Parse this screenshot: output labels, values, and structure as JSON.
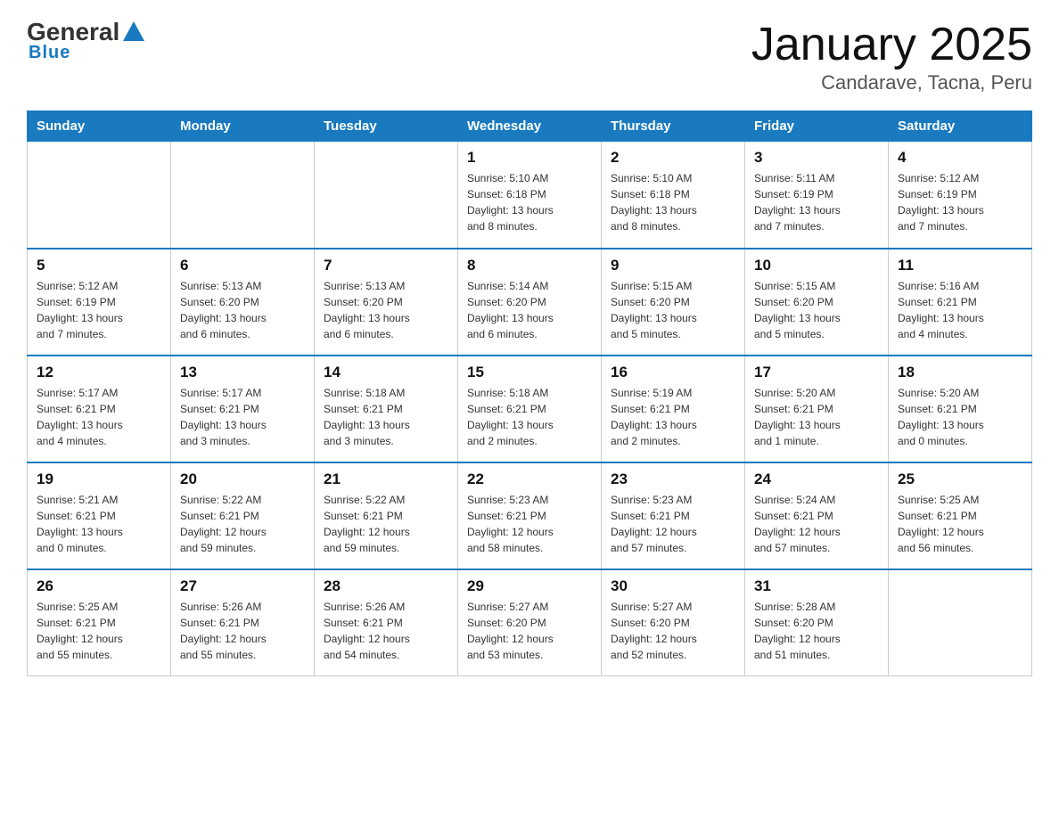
{
  "header": {
    "logo_general": "General",
    "logo_blue": "Blue",
    "title": "January 2025",
    "location": "Candarave, Tacna, Peru"
  },
  "days_of_week": [
    "Sunday",
    "Monday",
    "Tuesday",
    "Wednesday",
    "Thursday",
    "Friday",
    "Saturday"
  ],
  "weeks": [
    [
      {
        "day": "",
        "info": ""
      },
      {
        "day": "",
        "info": ""
      },
      {
        "day": "",
        "info": ""
      },
      {
        "day": "1",
        "info": "Sunrise: 5:10 AM\nSunset: 6:18 PM\nDaylight: 13 hours\nand 8 minutes."
      },
      {
        "day": "2",
        "info": "Sunrise: 5:10 AM\nSunset: 6:18 PM\nDaylight: 13 hours\nand 8 minutes."
      },
      {
        "day": "3",
        "info": "Sunrise: 5:11 AM\nSunset: 6:19 PM\nDaylight: 13 hours\nand 7 minutes."
      },
      {
        "day": "4",
        "info": "Sunrise: 5:12 AM\nSunset: 6:19 PM\nDaylight: 13 hours\nand 7 minutes."
      }
    ],
    [
      {
        "day": "5",
        "info": "Sunrise: 5:12 AM\nSunset: 6:19 PM\nDaylight: 13 hours\nand 7 minutes."
      },
      {
        "day": "6",
        "info": "Sunrise: 5:13 AM\nSunset: 6:20 PM\nDaylight: 13 hours\nand 6 minutes."
      },
      {
        "day": "7",
        "info": "Sunrise: 5:13 AM\nSunset: 6:20 PM\nDaylight: 13 hours\nand 6 minutes."
      },
      {
        "day": "8",
        "info": "Sunrise: 5:14 AM\nSunset: 6:20 PM\nDaylight: 13 hours\nand 6 minutes."
      },
      {
        "day": "9",
        "info": "Sunrise: 5:15 AM\nSunset: 6:20 PM\nDaylight: 13 hours\nand 5 minutes."
      },
      {
        "day": "10",
        "info": "Sunrise: 5:15 AM\nSunset: 6:20 PM\nDaylight: 13 hours\nand 5 minutes."
      },
      {
        "day": "11",
        "info": "Sunrise: 5:16 AM\nSunset: 6:21 PM\nDaylight: 13 hours\nand 4 minutes."
      }
    ],
    [
      {
        "day": "12",
        "info": "Sunrise: 5:17 AM\nSunset: 6:21 PM\nDaylight: 13 hours\nand 4 minutes."
      },
      {
        "day": "13",
        "info": "Sunrise: 5:17 AM\nSunset: 6:21 PM\nDaylight: 13 hours\nand 3 minutes."
      },
      {
        "day": "14",
        "info": "Sunrise: 5:18 AM\nSunset: 6:21 PM\nDaylight: 13 hours\nand 3 minutes."
      },
      {
        "day": "15",
        "info": "Sunrise: 5:18 AM\nSunset: 6:21 PM\nDaylight: 13 hours\nand 2 minutes."
      },
      {
        "day": "16",
        "info": "Sunrise: 5:19 AM\nSunset: 6:21 PM\nDaylight: 13 hours\nand 2 minutes."
      },
      {
        "day": "17",
        "info": "Sunrise: 5:20 AM\nSunset: 6:21 PM\nDaylight: 13 hours\nand 1 minute."
      },
      {
        "day": "18",
        "info": "Sunrise: 5:20 AM\nSunset: 6:21 PM\nDaylight: 13 hours\nand 0 minutes."
      }
    ],
    [
      {
        "day": "19",
        "info": "Sunrise: 5:21 AM\nSunset: 6:21 PM\nDaylight: 13 hours\nand 0 minutes."
      },
      {
        "day": "20",
        "info": "Sunrise: 5:22 AM\nSunset: 6:21 PM\nDaylight: 12 hours\nand 59 minutes."
      },
      {
        "day": "21",
        "info": "Sunrise: 5:22 AM\nSunset: 6:21 PM\nDaylight: 12 hours\nand 59 minutes."
      },
      {
        "day": "22",
        "info": "Sunrise: 5:23 AM\nSunset: 6:21 PM\nDaylight: 12 hours\nand 58 minutes."
      },
      {
        "day": "23",
        "info": "Sunrise: 5:23 AM\nSunset: 6:21 PM\nDaylight: 12 hours\nand 57 minutes."
      },
      {
        "day": "24",
        "info": "Sunrise: 5:24 AM\nSunset: 6:21 PM\nDaylight: 12 hours\nand 57 minutes."
      },
      {
        "day": "25",
        "info": "Sunrise: 5:25 AM\nSunset: 6:21 PM\nDaylight: 12 hours\nand 56 minutes."
      }
    ],
    [
      {
        "day": "26",
        "info": "Sunrise: 5:25 AM\nSunset: 6:21 PM\nDaylight: 12 hours\nand 55 minutes."
      },
      {
        "day": "27",
        "info": "Sunrise: 5:26 AM\nSunset: 6:21 PM\nDaylight: 12 hours\nand 55 minutes."
      },
      {
        "day": "28",
        "info": "Sunrise: 5:26 AM\nSunset: 6:21 PM\nDaylight: 12 hours\nand 54 minutes."
      },
      {
        "day": "29",
        "info": "Sunrise: 5:27 AM\nSunset: 6:20 PM\nDaylight: 12 hours\nand 53 minutes."
      },
      {
        "day": "30",
        "info": "Sunrise: 5:27 AM\nSunset: 6:20 PM\nDaylight: 12 hours\nand 52 minutes."
      },
      {
        "day": "31",
        "info": "Sunrise: 5:28 AM\nSunset: 6:20 PM\nDaylight: 12 hours\nand 51 minutes."
      },
      {
        "day": "",
        "info": ""
      }
    ]
  ]
}
